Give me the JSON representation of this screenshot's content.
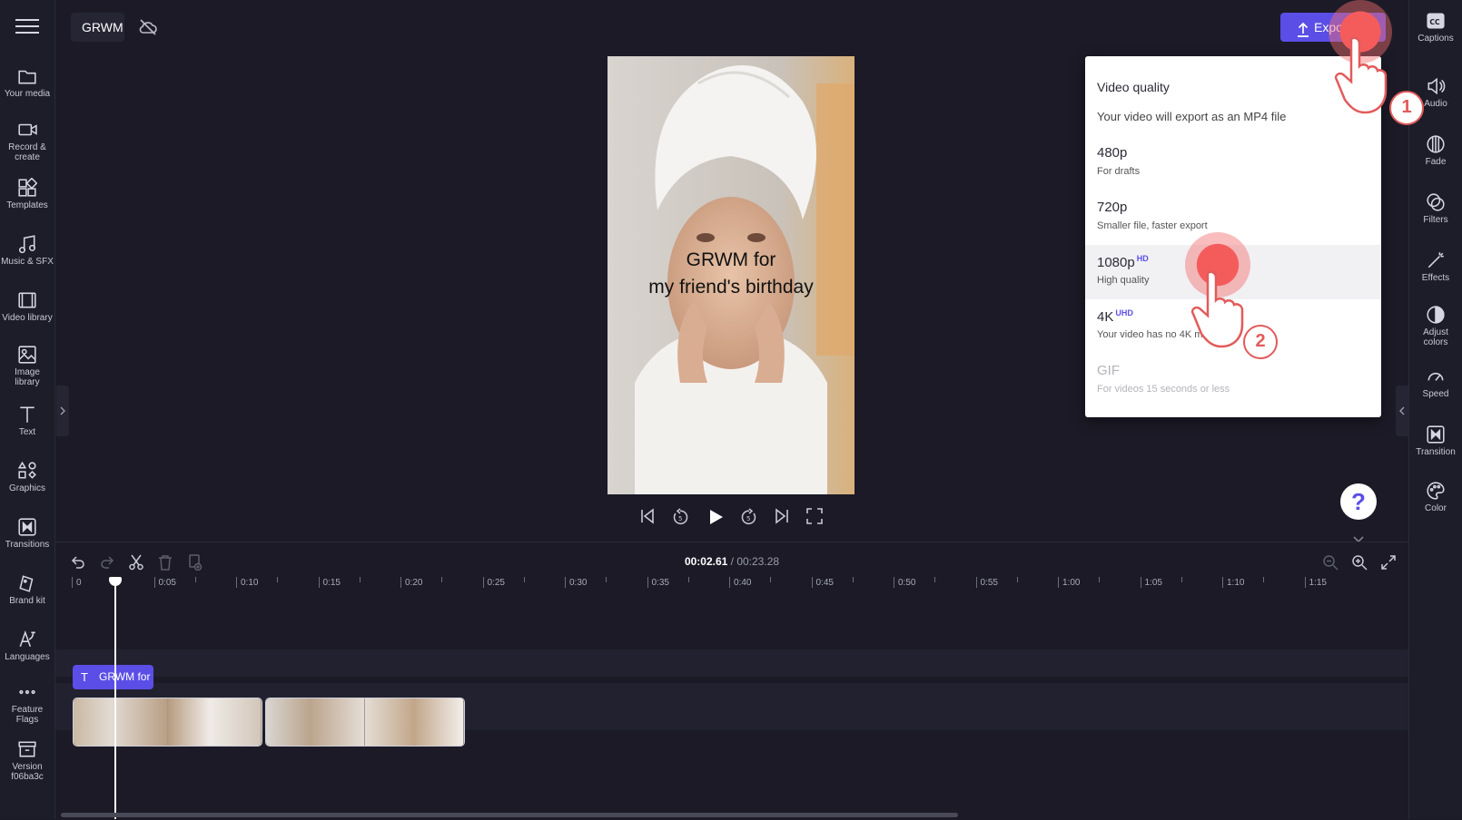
{
  "project": {
    "title": "GRWM for my friend's birthday"
  },
  "left_sidebar": [
    {
      "label": "Your media",
      "icon": "folder-icon"
    },
    {
      "label": "Record &\ncreate",
      "icon": "camera-icon"
    },
    {
      "label": "Templates",
      "icon": "templates-icon"
    },
    {
      "label": "Music & SFX",
      "icon": "music-icon"
    },
    {
      "label": "Video library",
      "icon": "film-icon"
    },
    {
      "label": "Image\nlibrary",
      "icon": "image-icon"
    },
    {
      "label": "Text",
      "icon": "text-icon"
    },
    {
      "label": "Graphics",
      "icon": "shapes-icon"
    },
    {
      "label": "Transitions",
      "icon": "transitions-icon"
    },
    {
      "label": "Brand kit",
      "icon": "brand-kit-icon"
    },
    {
      "label": "Languages",
      "icon": "languages-icon"
    },
    {
      "label": "Feature\nFlags",
      "icon": "more-icon"
    },
    {
      "label": "Version\nf06ba3c",
      "icon": "archive-icon"
    }
  ],
  "right_sidebar": [
    {
      "label": "Captions",
      "icon": "captions-icon"
    },
    {
      "label": "Audio",
      "icon": "speaker-icon"
    },
    {
      "label": "Fade",
      "icon": "fade-icon"
    },
    {
      "label": "Filters",
      "icon": "filters-icon"
    },
    {
      "label": "Effects",
      "icon": "magic-wand-icon"
    },
    {
      "label": "Adjust\ncolors",
      "icon": "contrast-icon"
    },
    {
      "label": "Speed",
      "icon": "speedometer-icon"
    },
    {
      "label": "Transition",
      "icon": "transition-icon"
    },
    {
      "label": "Color",
      "icon": "palette-icon"
    }
  ],
  "export": {
    "label": "Export"
  },
  "preview": {
    "caption_line1": "GRWM for",
    "caption_line2": "my friend's birthday"
  },
  "export_panel": {
    "title": "Video quality",
    "subtitle": "Your video will export as an MP4 file",
    "options": [
      {
        "name": "480p",
        "badge": "",
        "desc": "For drafts",
        "state": "normal"
      },
      {
        "name": "720p",
        "badge": "",
        "desc": "Smaller file, faster export",
        "state": "normal"
      },
      {
        "name": "1080p",
        "badge": "HD",
        "desc": "High quality",
        "state": "selected"
      },
      {
        "name": "4K",
        "badge": "UHD",
        "desc": "Your video has no 4K media",
        "state": "normal"
      },
      {
        "name": "GIF",
        "badge": "",
        "desc": "For videos 15 seconds or less",
        "state": "disabled"
      }
    ]
  },
  "annotations": {
    "step1": "1",
    "step2": "2"
  },
  "help": {
    "label": "?"
  },
  "timeline": {
    "current_time": "00:02.61",
    "separator": " / ",
    "total_time": "00:23.28",
    "ruler": [
      "0",
      "0:05",
      "0:10",
      "0:15",
      "0:20",
      "0:25",
      "0:30",
      "0:35",
      "0:40",
      "0:45",
      "0:50",
      "0:55",
      "1:00",
      "1:05",
      "1:10",
      "1:15"
    ],
    "text_clip": "GRWM for",
    "playhead_time_fraction": 0.112
  },
  "colors": {
    "accent": "#5b4ee6",
    "background": "#1b1a26",
    "panel": "#ffffff",
    "highlight": "#f26d6d"
  }
}
